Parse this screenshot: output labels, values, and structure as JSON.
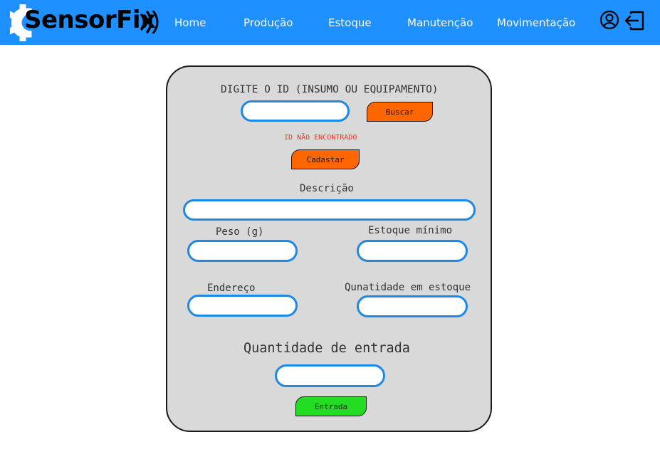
{
  "brand": {
    "name": "SensorFix",
    "accent": "#1e90ff",
    "icons": [
      "gear-icon",
      "signal-waves-icon"
    ]
  },
  "nav": {
    "items": [
      {
        "label": "Home"
      },
      {
        "label": "Produção"
      },
      {
        "label": "Estoque"
      },
      {
        "label": "Manutenção"
      },
      {
        "label": "Movimentação"
      }
    ],
    "icons": [
      "user-icon",
      "logout-icon"
    ]
  },
  "form": {
    "search_title": "DIGITE O ID (INSUMO OU EQUIPAMENTO)",
    "id_input": {
      "value": "",
      "placeholder": ""
    },
    "search_button": "Buscar",
    "error_message": "ID NÃO ENCONTRADO",
    "register_button": "Cadastar",
    "fields": {
      "descricao": {
        "label": "Descrição",
        "value": ""
      },
      "peso": {
        "label": "Peso (g)",
        "value": ""
      },
      "estoque_minimo": {
        "label": "Estoque mínimo",
        "value": ""
      },
      "endereco": {
        "label": "Endereço",
        "value": ""
      },
      "quantidade_estoque": {
        "label": "Qunatidade em estoque",
        "value": ""
      }
    },
    "entry_label": "Quantidade de entrada",
    "entry_input": {
      "value": ""
    },
    "entry_button": "Entrada"
  },
  "colors": {
    "navbar": "#1e90ff",
    "card_background": "#d9d9d9",
    "input_border": "#1e88e5",
    "search_button": "#ff6600",
    "register_button": "#ff6600",
    "entry_button": "#22dd22",
    "error_text": "#e53935"
  }
}
